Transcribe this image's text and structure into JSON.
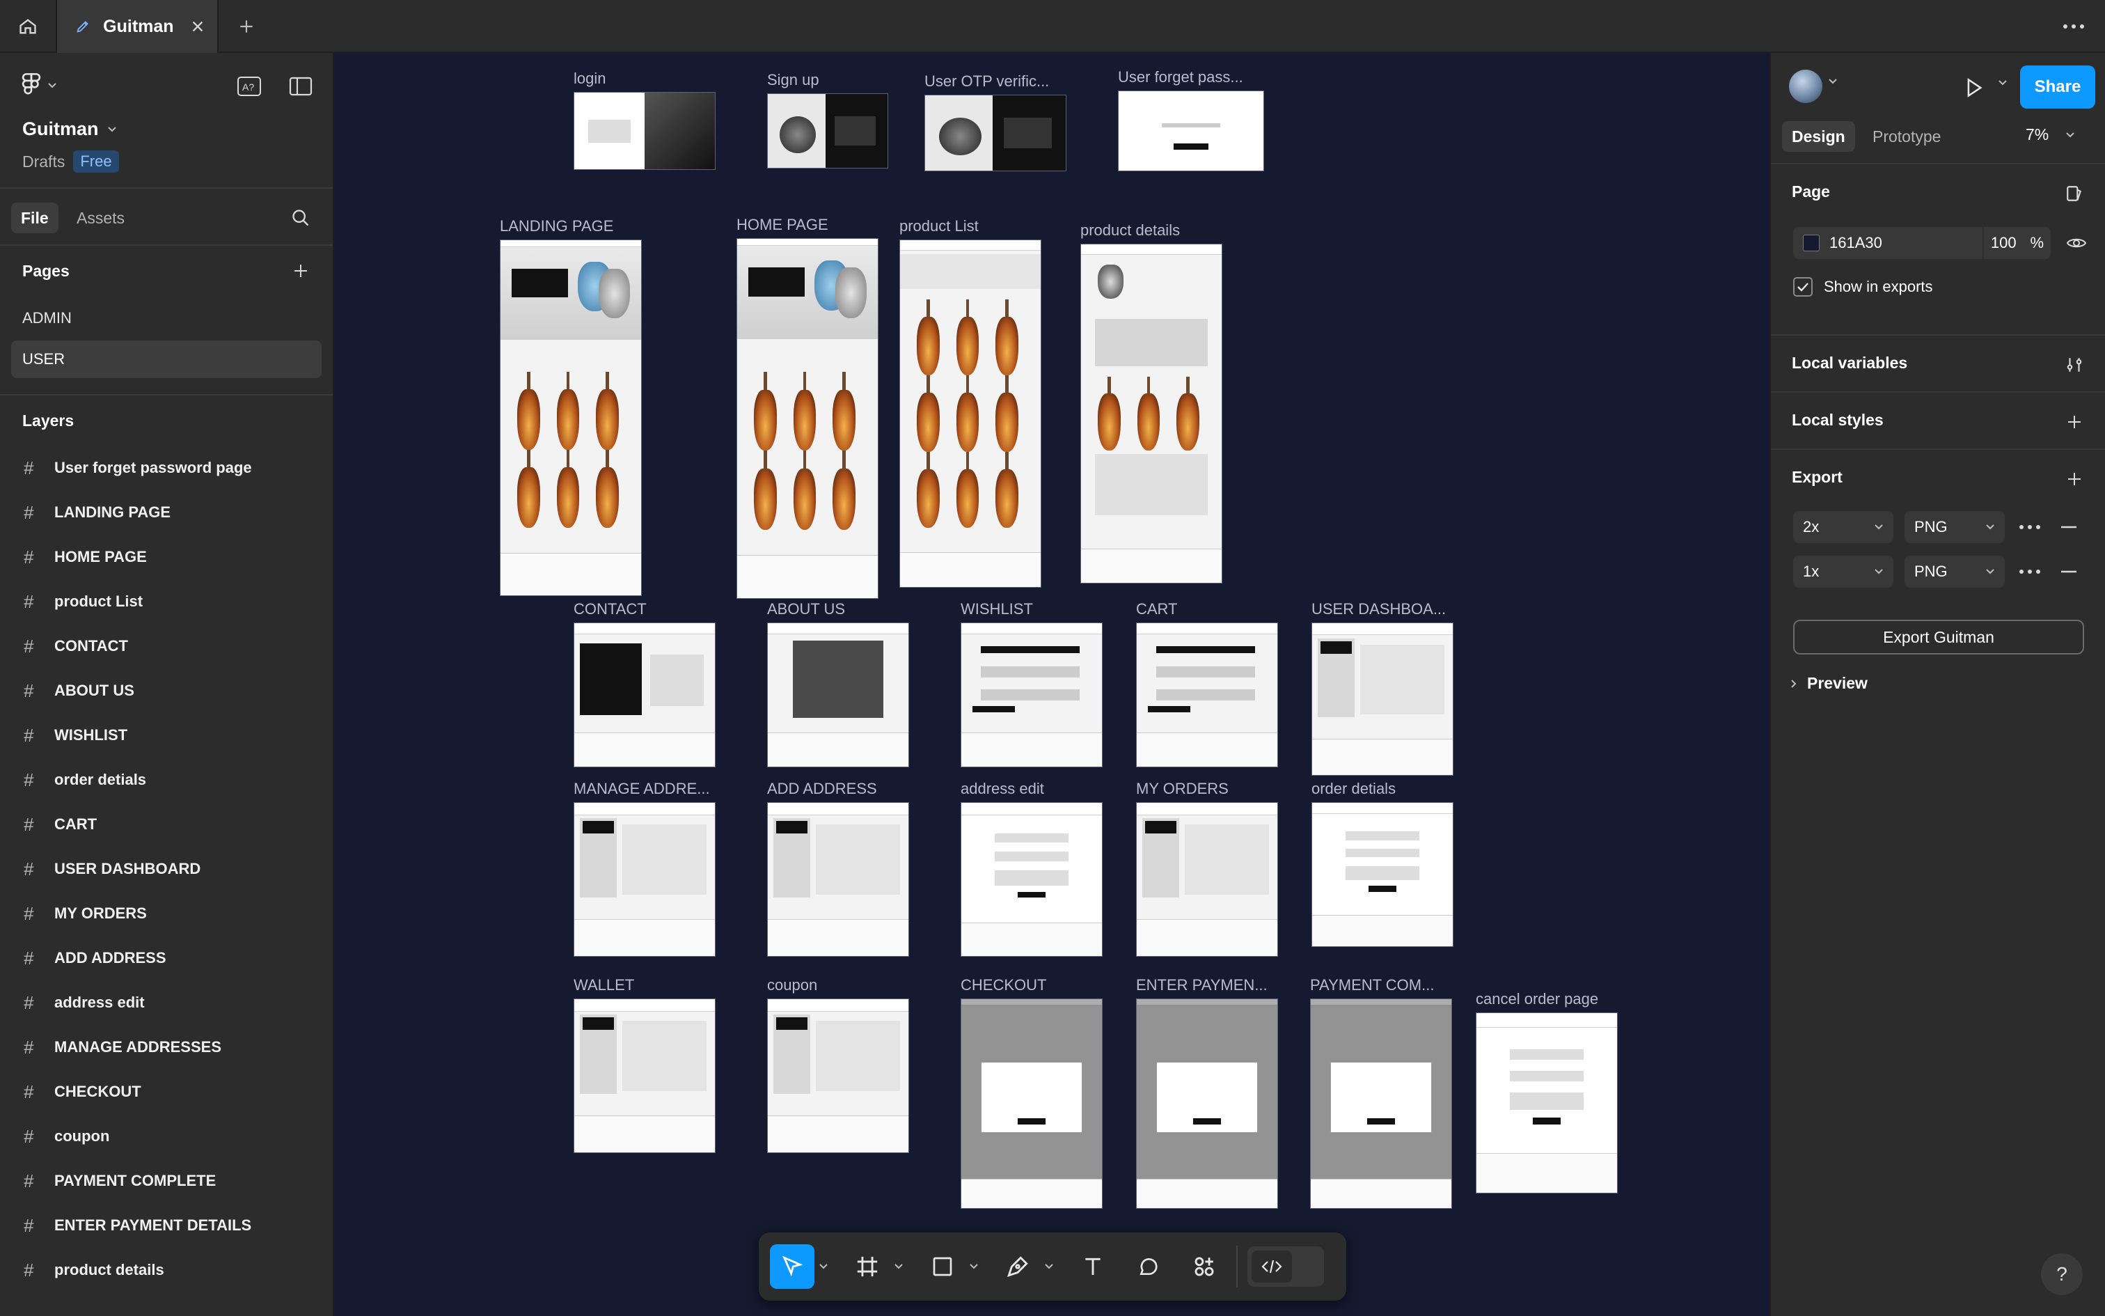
{
  "tabbar": {
    "file_tab_title": "Guitman",
    "icons": [
      "home-icon",
      "figma-file-icon",
      "close-icon",
      "plus-icon",
      "more-icon"
    ]
  },
  "left_panel": {
    "file_name": "Guitman",
    "location": "Drafts",
    "plan_badge": "Free",
    "tabs": {
      "file": "File",
      "assets": "Assets"
    },
    "pages_heading": "Pages",
    "pages": [
      {
        "label": "ADMIN",
        "active": false
      },
      {
        "label": "USER",
        "active": true
      }
    ],
    "layers_heading": "Layers",
    "layers": [
      "User forget password page",
      "LANDING PAGE",
      "HOME PAGE",
      "product List",
      "CONTACT",
      "ABOUT US",
      "WISHLIST",
      "order detials",
      "CART",
      "USER DASHBOARD",
      "MY ORDERS",
      "ADD ADDRESS",
      "address edit",
      "MANAGE ADDRESSES",
      "CHECKOUT",
      "coupon",
      "PAYMENT COMPLETE",
      "ENTER PAYMENT DETAILS",
      "product details"
    ]
  },
  "right_panel": {
    "share_label": "Share",
    "tabs": {
      "design": "Design",
      "prototype": "Prototype"
    },
    "zoom": "7%",
    "page_section": {
      "title": "Page",
      "background_hex": "161A30",
      "opacity": "100",
      "opacity_unit": "%",
      "show_in_exports": "Show in exports",
      "show_in_exports_checked": true
    },
    "local_variables": "Local variables",
    "local_styles": "Local styles",
    "export_section": {
      "title": "Export",
      "rows": [
        {
          "scale": "2x",
          "format": "PNG"
        },
        {
          "scale": "1x",
          "format": "PNG"
        }
      ],
      "export_button": "Export Guitman",
      "preview": "Preview"
    },
    "help": "?"
  },
  "canvas": {
    "background": "#161A30",
    "frames": [
      {
        "id": "login",
        "label": "login",
        "kind": "auth"
      },
      {
        "id": "signup",
        "label": "Sign up",
        "kind": "auth-dark"
      },
      {
        "id": "otp",
        "label": "User OTP verific...",
        "kind": "auth-dark"
      },
      {
        "id": "forget",
        "label": "User forget pass...",
        "kind": "auth-plain"
      },
      {
        "id": "landing",
        "label": "LANDING PAGE",
        "kind": "long"
      },
      {
        "id": "home",
        "label": "HOME PAGE",
        "kind": "long"
      },
      {
        "id": "plist",
        "label": "product List",
        "kind": "grid"
      },
      {
        "id": "pdetails",
        "label": "product details",
        "kind": "details"
      },
      {
        "id": "contact",
        "label": "CONTACT",
        "kind": "contact"
      },
      {
        "id": "about",
        "label": "ABOUT US",
        "kind": "about"
      },
      {
        "id": "wishlist",
        "label": "WISHLIST",
        "kind": "list"
      },
      {
        "id": "cart",
        "label": "CART",
        "kind": "list"
      },
      {
        "id": "dashboard",
        "label": "USER DASHBOA...",
        "kind": "dash"
      },
      {
        "id": "manage",
        "label": "MANAGE ADDRE...",
        "kind": "dash"
      },
      {
        "id": "addaddr",
        "label": "ADD ADDRESS",
        "kind": "dash"
      },
      {
        "id": "addredit",
        "label": "address edit",
        "kind": "form"
      },
      {
        "id": "myorders",
        "label": "MY ORDERS",
        "kind": "dash"
      },
      {
        "id": "orderdet",
        "label": "order detials",
        "kind": "form"
      },
      {
        "id": "wallet",
        "label": "WALLET",
        "kind": "dash"
      },
      {
        "id": "coupon",
        "label": "coupon",
        "kind": "dash"
      },
      {
        "id": "checkout",
        "label": "CHECKOUT",
        "kind": "modal"
      },
      {
        "id": "enterpay",
        "label": "ENTER PAYMEN...",
        "kind": "modal"
      },
      {
        "id": "paycomplete",
        "label": "PAYMENT COM...",
        "kind": "modal"
      },
      {
        "id": "cancel",
        "label": "cancel order page",
        "kind": "form"
      }
    ]
  },
  "toolbar": {
    "tools": [
      "move-tool",
      "frame-tool",
      "shape-tool",
      "pen-tool",
      "text-tool",
      "comment-tool",
      "components-tool",
      "dev-mode-toggle"
    ],
    "active_tool": "move-tool"
  }
}
